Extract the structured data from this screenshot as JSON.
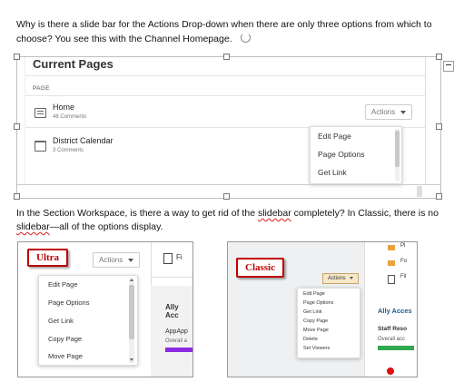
{
  "paragraph1": {
    "line1": "Why is there a slide bar for the Actions Drop-down when there are only three options from which to",
    "line2": "choose? You see this with the Channel Homepage."
  },
  "paragraph2": {
    "line1_pre": "In the Section Workspace, is there a way to get rid of the ",
    "line1_err": "slidebar",
    "line1_post": " completely?  In Classic, there is no",
    "line2_err": "slidebar",
    "line2_post": "—all of the options display."
  },
  "screenshot1": {
    "title": "Current Pages",
    "section_label": "PAGE",
    "rows": [
      {
        "title": "Home",
        "sub": "48 Comments"
      },
      {
        "title": "District Calendar",
        "sub": "3 Comments"
      }
    ],
    "actions_label": "Actions",
    "menu_items": [
      "Edit Page",
      "Page Options",
      "Get Link"
    ]
  },
  "screenshot2": {
    "tag": "Ultra",
    "actions_label": "Actions",
    "menu_items": [
      "Edit Page",
      "Page Options",
      "Get Link",
      "Copy Page",
      "Move Page"
    ],
    "side_text": "Fi",
    "side_heading": "Ally Acc",
    "side_item": "AppApp",
    "side_sub": "Overall a"
  },
  "screenshot3": {
    "tag": "Classic",
    "actions_label": "Actions",
    "menu_items": [
      "Edit Page",
      "Page Options",
      "Get Link",
      "Copy Page",
      "Move Page",
      "Delete",
      "Set Viewers"
    ],
    "side_items": [
      "Pl",
      "Fo",
      "Fil"
    ],
    "side_heading": "Ally Acces",
    "side_sub1": "Staff Reso",
    "side_sub2": "Overall acc"
  }
}
